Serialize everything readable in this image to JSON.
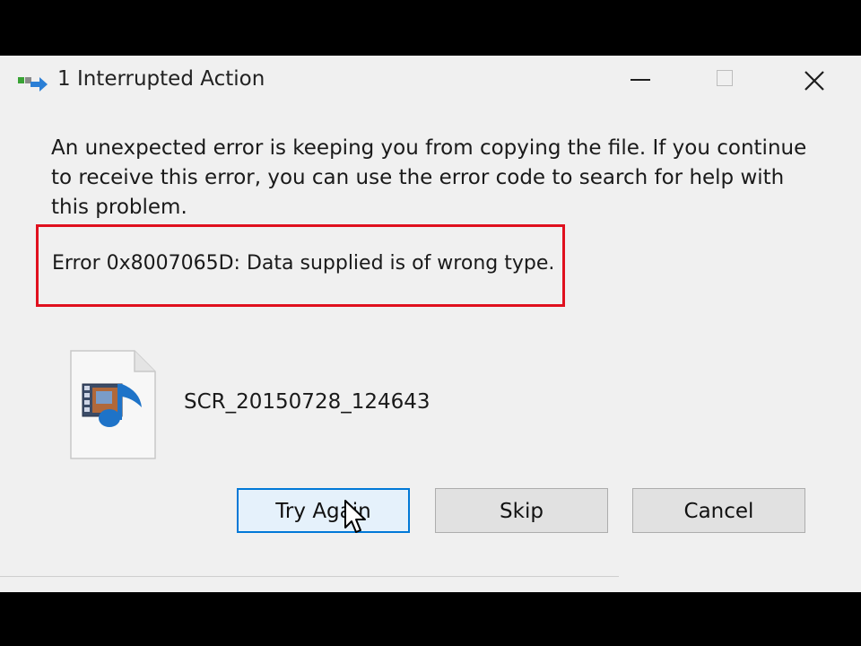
{
  "window": {
    "title": "1 Interrupted Action",
    "icon": "copy-arrow-icon",
    "controls": [
      "minimize-icon",
      "maximize-icon",
      "close-icon"
    ]
  },
  "message": "An unexpected error is keeping you from copying the file. If you continue to receive this error, you can use the error code to search for help with this problem.",
  "error": {
    "text": "Error 0x8007065D: Data supplied is of wrong type.",
    "highlight_color": "#e0101e"
  },
  "file": {
    "name": "SCR_20150728_124643",
    "icon": "media-file-icon"
  },
  "buttons": {
    "try_again": "Try Again",
    "skip": "Skip",
    "cancel": "Cancel"
  },
  "colors": {
    "accent": "#0078d7",
    "dialog_bg": "#f0f0f0"
  }
}
